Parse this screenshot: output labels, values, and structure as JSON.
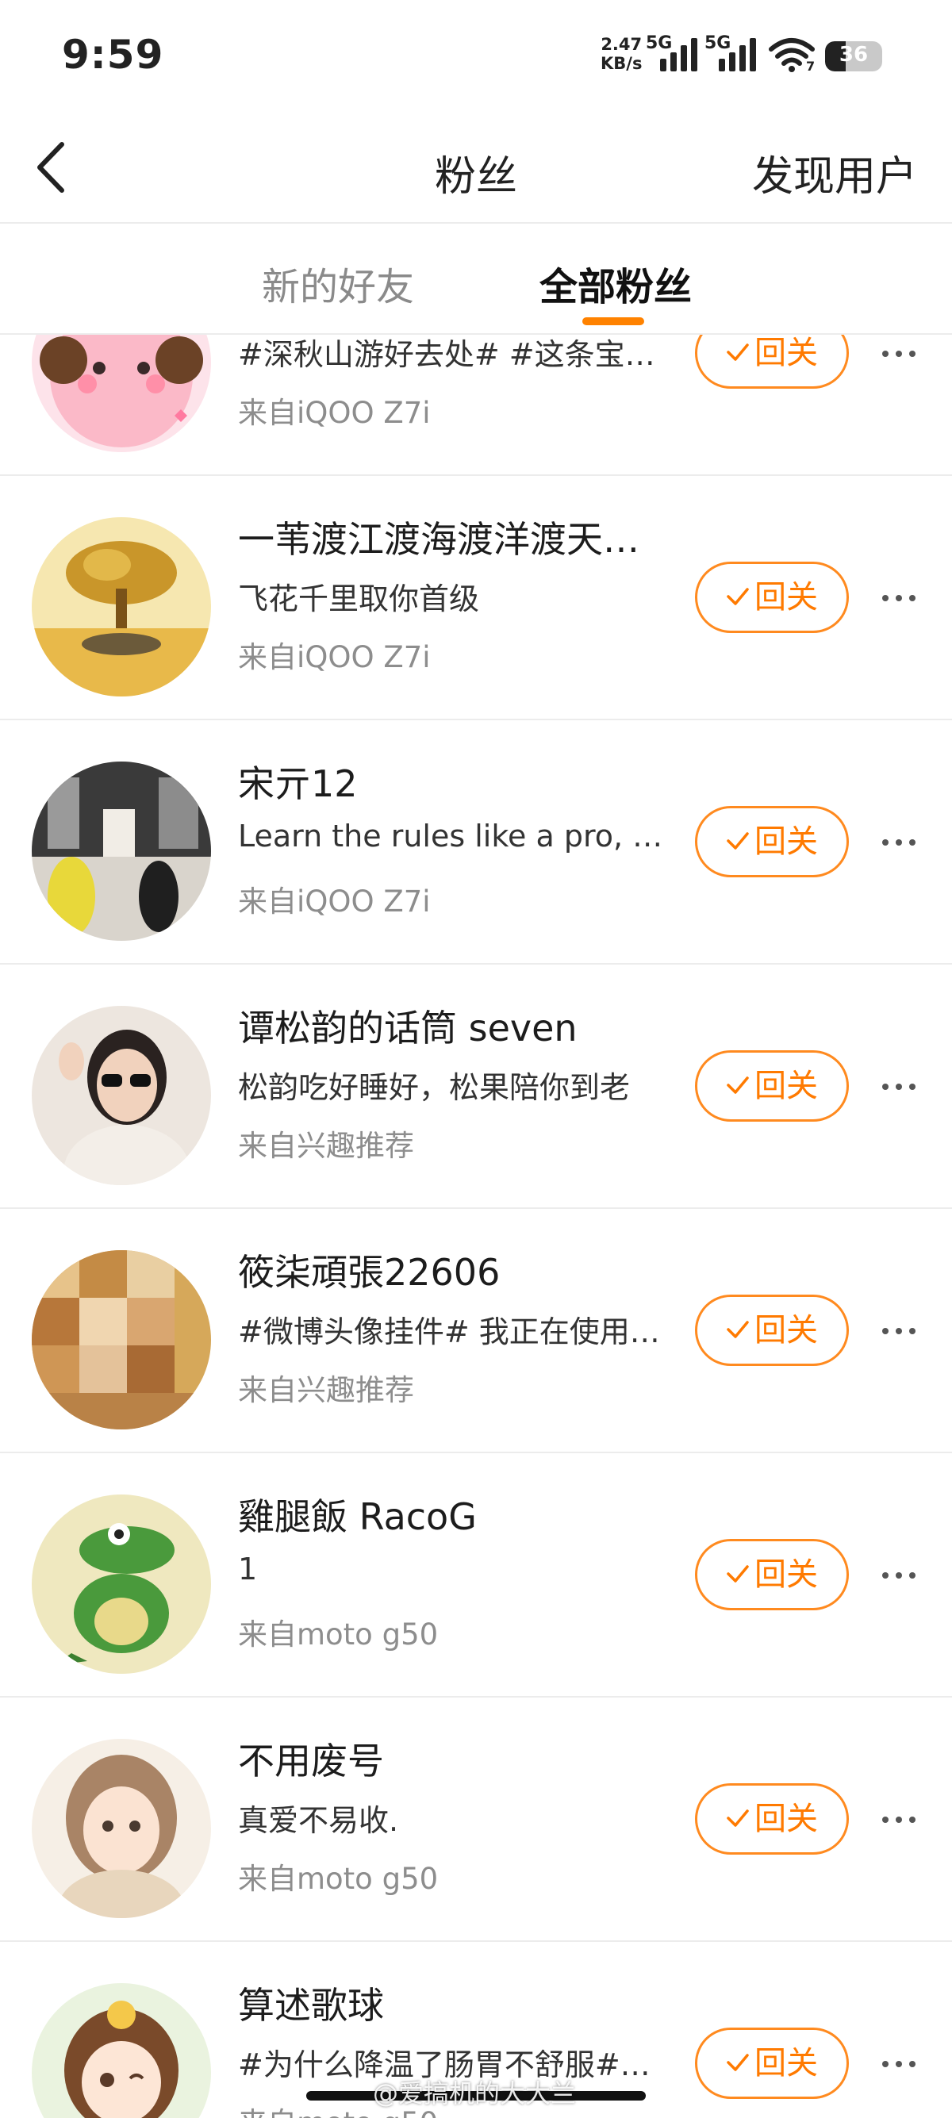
{
  "status_bar": {
    "time": "9:59",
    "net_speed_value": "2.47",
    "net_speed_unit": "KB/s",
    "sim1_label": "5G",
    "sim2_label": "5G",
    "wifi_label": "7",
    "battery_level": "36"
  },
  "nav": {
    "title": "粉丝",
    "right_action": "发现用户"
  },
  "tabs": [
    {
      "label": "新的好友",
      "active": false
    },
    {
      "label": "全部粉丝",
      "active": true
    }
  ],
  "accent_color": "#ff8200",
  "fans": [
    {
      "name": "",
      "desc": "#深秋山游好去处# #这条宝…",
      "source": "来自iQOO Z7i",
      "button": "回关",
      "avatar_icon": "pink-bear-avatar"
    },
    {
      "name": "一苇渡江渡海渡洋渡天…",
      "desc": "飞花千里取你首级",
      "source": "来自iQOO Z7i",
      "button": "回关",
      "avatar_icon": "golden-tree-avatar"
    },
    {
      "name": "宋亓12",
      "desc": "Learn the rules like a pro, so…",
      "source": "来自iQOO Z7i",
      "button": "回关",
      "avatar_icon": "room-photo-avatar"
    },
    {
      "name": "谭松韵的话筒 seven",
      "desc": "松韵吃好睡好，松果陪你到老",
      "source": "来自兴趣推荐",
      "button": "回关",
      "avatar_icon": "girl-sunglasses-avatar"
    },
    {
      "name": "筱柒頑張22606",
      "desc": "#微博头像挂件# 我正在使用…",
      "source": "来自兴趣推荐",
      "button": "回关",
      "avatar_icon": "pixelated-avatar"
    },
    {
      "name": "雞腿飯 RacoG",
      "desc": "1",
      "source": "来自moto g50",
      "button": "回关",
      "avatar_icon": "crocodile-avatar"
    },
    {
      "name": "不用废号",
      "desc": "真爱不易收.",
      "source": "来自moto g50",
      "button": "回关",
      "avatar_icon": "anime-girl-avatar"
    },
    {
      "name": "算述歌球",
      "desc": "#为什么降温了肠胃不舒服#…",
      "source": "来自moto g50",
      "button": "回关",
      "avatar_icon": "chibi-girl-avatar"
    }
  ],
  "watermark": "@爱搞机的大大兰"
}
